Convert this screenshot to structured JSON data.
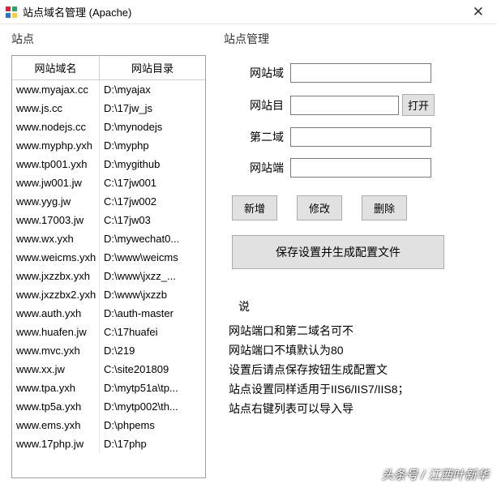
{
  "titlebar": {
    "title": "站点域名管理 (Apache)"
  },
  "left": {
    "label": "站点",
    "headers": [
      "网站域名",
      "网站目录"
    ],
    "rows": [
      {
        "domain": "www.myajax.cc",
        "dir": "D:\\myajax"
      },
      {
        "domain": "www.js.cc",
        "dir": "D:\\17jw_js"
      },
      {
        "domain": "www.nodejs.cc",
        "dir": "D:\\mynodejs"
      },
      {
        "domain": "www.myphp.yxh",
        "dir": "D:\\myphp"
      },
      {
        "domain": "www.tp001.yxh",
        "dir": "D:\\mygithub"
      },
      {
        "domain": "www.jw001.jw",
        "dir": "C:\\17jw001"
      },
      {
        "domain": "www.yyg.jw",
        "dir": "C:\\17jw002"
      },
      {
        "domain": "www.17003.jw",
        "dir": "C:\\17jw03"
      },
      {
        "domain": "www.wx.yxh",
        "dir": "D:\\mywechat0..."
      },
      {
        "domain": "www.weicms.yxh",
        "dir": "D:\\www\\weicms"
      },
      {
        "domain": "www.jxzzbx.yxh",
        "dir": "D:\\www\\jxzz_..."
      },
      {
        "domain": "www.jxzzbx2.yxh",
        "dir": "D:\\www\\jxzzb"
      },
      {
        "domain": "www.auth.yxh",
        "dir": "D:\\auth-master"
      },
      {
        "domain": "www.huafen.jw",
        "dir": "C:\\17huafei"
      },
      {
        "domain": "www.mvc.yxh",
        "dir": "D:\\219"
      },
      {
        "domain": "www.xx.jw",
        "dir": "C:\\site201809"
      },
      {
        "domain": "www.tpa.yxh",
        "dir": "D:\\mytp51a\\tp..."
      },
      {
        "domain": "www.tp5a.yxh",
        "dir": "D:\\mytp002\\th..."
      },
      {
        "domain": "www.ems.yxh",
        "dir": "D:\\phpems"
      },
      {
        "domain": "www.17php.jw",
        "dir": "D:\\17php"
      }
    ]
  },
  "right": {
    "label": "站点管理",
    "fields": {
      "domain": {
        "label": "网站域",
        "value": ""
      },
      "dir": {
        "label": "网站目",
        "value": "",
        "open": "打开"
      },
      "second": {
        "label": "第二域",
        "value": ""
      },
      "port": {
        "label": "网站端",
        "value": ""
      }
    },
    "buttons": {
      "add": "新增",
      "edit": "修改",
      "del": "删除"
    },
    "save": "保存设置并生成配置文件",
    "hint_title": "说",
    "hints": [
      "网站端口和第二域名可不",
      "网站端口不填默认为80",
      "设置后请点保存按钮生成配置文",
      "站点设置同样适用于IIS6/IIS7/IIS8；",
      "站点右键列表可以导入导"
    ]
  },
  "watermark": "头条号 / 江西叶新华"
}
